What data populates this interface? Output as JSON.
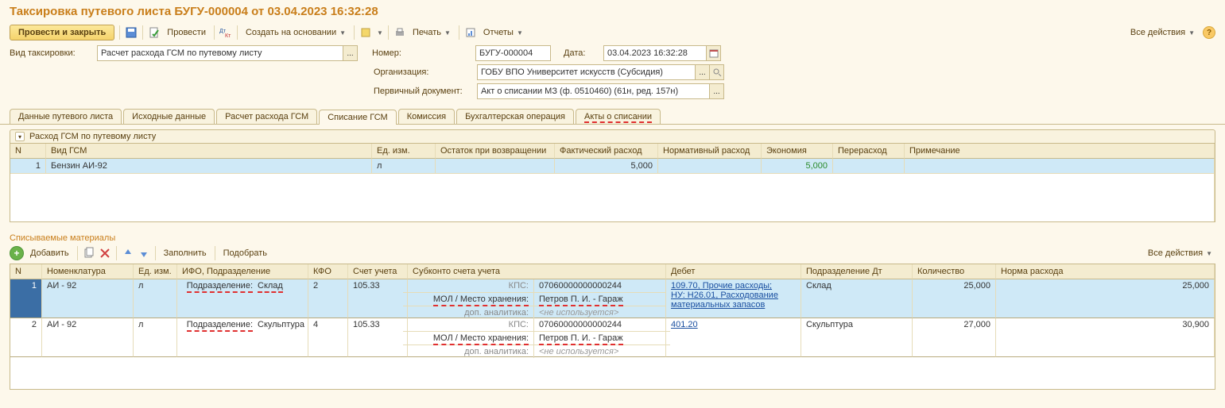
{
  "title": "Таксировка путевого листа БУГУ-000004 от 03.04.2023 16:32:28",
  "toolbar": {
    "post_close": "Провести и закрыть",
    "post": "Провести",
    "create_based": "Создать на основании",
    "print": "Печать",
    "reports": "Отчеты",
    "all_actions": "Все действия"
  },
  "form": {
    "taxing_type_label": "Вид таксировки:",
    "taxing_type_value": "Расчет расхода ГСМ по путевому листу",
    "number_label": "Номер:",
    "number_value": "БУГУ-000004",
    "date_label": "Дата:",
    "date_value": "03.04.2023 16:32:28",
    "org_label": "Организация:",
    "org_value": "ГОБУ ВПО Университет искусств (Субсидия)",
    "primary_doc_label": "Первичный документ:",
    "primary_doc_value": "Акт о списании МЗ (ф. 0510460) (61н, ред. 157н)"
  },
  "tabs": {
    "t1": "Данные путевого листа",
    "t2": "Исходные данные",
    "t3": "Расчет расхода ГСМ",
    "t4": "Списание ГСМ",
    "t5": "Комиссия",
    "t6": "Бухгалтерская операция",
    "t7": "Акты о списании"
  },
  "gsm_section": {
    "title": "Расход ГСМ по путевому листу",
    "headers": {
      "n": "N",
      "type": "Вид ГСМ",
      "unit": "Ед. изм.",
      "return_balance": "Остаток при возвращении",
      "actual": "Фактический расход",
      "normative": "Нормативный расход",
      "economy": "Экономия",
      "overrun": "Перерасход",
      "note": "Примечание"
    },
    "row": {
      "n": "1",
      "type": "Бензин АИ-92",
      "unit": "л",
      "actual": "5,000",
      "economy": "5,000"
    }
  },
  "materials": {
    "title": "Списываемые материалы",
    "toolbar": {
      "add": "Добавить",
      "fill": "Заполнить",
      "pick": "Подобрать",
      "all_actions": "Все действия"
    },
    "headers": {
      "n": "N",
      "nomenclature": "Номенклатура",
      "unit": "Ед. изм.",
      "ifo": "ИФО, Подразделение",
      "kfo": "КФО",
      "account": "Счет учета",
      "subconto": "Субконто счета учета",
      "debit": "Дебет",
      "dept_dt": "Подразделение Дт",
      "qty": "Количество",
      "norm": "Норма расхода"
    },
    "sublabels": {
      "subdivision": "Подразделение:",
      "kps": "КПС:",
      "mol": "МОЛ / Место хранения:",
      "dop": "доп. аналитика:",
      "not_used": "<не используется>"
    },
    "rows": [
      {
        "n": "1",
        "nomenclature": "АИ - 92",
        "unit": "л",
        "subdivision": "Склад",
        "kfo": "2",
        "account": "105.33",
        "kps": "07060000000000244",
        "mol": "Петров П. И. - Гараж",
        "debit1": "109.70, Прочие расходы;",
        "debit2": "НУ: Н26.01, Расходование материальных запасов",
        "dept_dt": "Склад",
        "qty": "25,000",
        "norm": "25,000"
      },
      {
        "n": "2",
        "nomenclature": "АИ - 92",
        "unit": "л",
        "subdivision": "Скульптура",
        "kfo": "4",
        "account": "105.33",
        "kps": "07060000000000244",
        "mol": "Петров П. И. - Гараж",
        "debit1": "401.20",
        "dept_dt": "Скульптура",
        "qty": "27,000",
        "norm": "30,900"
      }
    ]
  }
}
